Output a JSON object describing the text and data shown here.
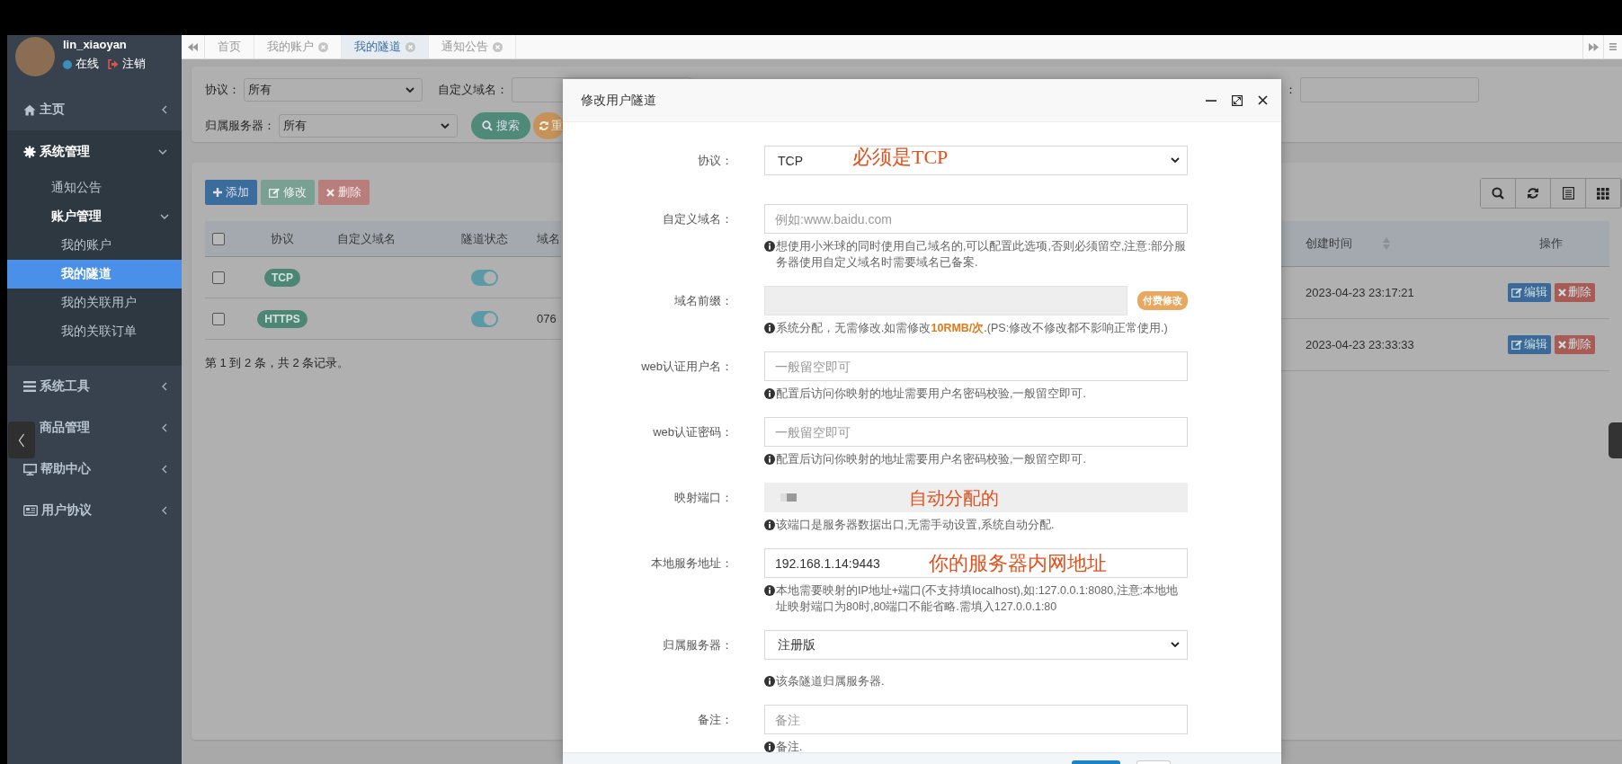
{
  "sidebar": {
    "user": {
      "name": "lin_xiaoyan",
      "status": "在线",
      "logout": "注销"
    },
    "menu": [
      {
        "label": "主页",
        "expanded": false,
        "selected": false
      },
      {
        "label": "系统管理",
        "expanded": true,
        "selected": false,
        "children": [
          {
            "label": "通知公告",
            "selected": false
          },
          {
            "label": "账户管理",
            "expanded": true,
            "selected": false,
            "children": [
              {
                "label": "我的账户",
                "selected": false
              },
              {
                "label": "我的隧道",
                "selected": true
              },
              {
                "label": "我的关联用户",
                "selected": false
              },
              {
                "label": "我的关联订单",
                "selected": false
              }
            ]
          }
        ]
      },
      {
        "label": "系统工具",
        "expanded": false,
        "selected": false
      },
      {
        "label": "商品管理",
        "expanded": false,
        "selected": false
      },
      {
        "label": "帮助中心",
        "expanded": false,
        "selected": false
      },
      {
        "label": "用户协议",
        "expanded": false,
        "selected": false
      }
    ]
  },
  "tabs": [
    {
      "label": "首页",
      "closable": false,
      "selected": false
    },
    {
      "label": "我的账户",
      "closable": true,
      "selected": false
    },
    {
      "label": "我的隧道",
      "closable": true,
      "selected": true
    },
    {
      "label": "通知公告",
      "closable": true,
      "selected": false
    }
  ],
  "filters": [
    [
      {
        "label": "协议：",
        "kind": "select",
        "value": "所有"
      },
      {
        "label": "自定义域名：",
        "kind": "input"
      },
      {
        "label": "：",
        "kind": "input"
      }
    ],
    [
      {
        "label": "归属服务器：",
        "kind": "select",
        "value": "所有"
      }
    ]
  ],
  "filter_buttons": [
    {
      "label": "搜索",
      "kind": "search"
    },
    {
      "label": "重",
      "kind": "reset"
    }
  ],
  "toolbar": [
    {
      "label": "添加",
      "kind": "add",
      "disabled": false
    },
    {
      "label": "修改",
      "kind": "edit",
      "disabled": true
    },
    {
      "label": "删除",
      "kind": "delete",
      "disabled": true
    }
  ],
  "table": {
    "all_checked": false,
    "columns": [
      {
        "label": "协议"
      },
      {
        "label": "自定义域名"
      },
      {
        "label": "隧道状态"
      },
      {
        "label": "域名"
      },
      {
        "label": "创建时间",
        "sortable": true
      },
      {
        "label": "操作"
      }
    ],
    "rows": [
      {
        "checked": false,
        "protocol": "TCP",
        "enabled": true,
        "created": "2023-04-23 23:17:21",
        "actions": [
          {
            "label": "编辑",
            "kind": "edit"
          },
          {
            "label": "删除",
            "kind": "delete"
          }
        ]
      },
      {
        "checked": false,
        "protocol": "HTTPS",
        "enabled": true,
        "domain": "076",
        "created": "2023-04-23 23:33:33",
        "actions": [
          {
            "label": "编辑",
            "kind": "edit"
          },
          {
            "label": "删除",
            "kind": "delete"
          }
        ]
      }
    ]
  },
  "pagination": "第 1 到 2 条，共 2 条记录。",
  "modal": {
    "title": "修改用户隧道",
    "fields": [
      {
        "label": "协议：",
        "kind": "select",
        "value": "TCP",
        "annotation": "必须是TCP"
      },
      {
        "label": "自定义域名：",
        "kind": "input",
        "placeholder": "例如:www.baidu.com",
        "help": "想使用小米球的同时使用自己域名的,可以配置此选项,否则必须留空,注意:部分服务器使用自定义域名时需要域名已备案."
      },
      {
        "label": "域名前缀：",
        "kind": "readonly",
        "badge": "付费修改",
        "help": "系统分配，无需修改.如需修改**10RMB/次**.(PS:修改不修改都不影响正常使用.)"
      },
      {
        "label": "web认证用户名：",
        "kind": "input",
        "placeholder": "一般留空即可",
        "help": "配置后访问你映射的地址需要用户名密码校验,一般留空即可."
      },
      {
        "label": "web认证密码：",
        "kind": "input",
        "placeholder": "一般留空即可",
        "help": "配置后访问你映射的地址需要用户名密码校验,一般留空即可."
      },
      {
        "label": "映射端口：",
        "kind": "disabled",
        "annotation": "自动分配的",
        "help": "该端口是服务器数据出口,无需手动设置,系统自动分配."
      },
      {
        "label": "本地服务地址：",
        "kind": "input",
        "value": "192.168.1.14:9443",
        "annotation": "你的服务器内网地址",
        "help": "本地需要映射的IP地址+端口(不支持填localhost),如:127.0.0.1:8080,注意:本地地址映射端口为80时,80端口不能省略.需填入127.0.0.1:80"
      },
      {
        "label": "归属服务器：",
        "kind": "select",
        "value": "注册版",
        "help": "该条隧道归属服务器."
      },
      {
        "label": "备注：",
        "kind": "input",
        "placeholder": "备注",
        "help": "备注."
      }
    ]
  }
}
